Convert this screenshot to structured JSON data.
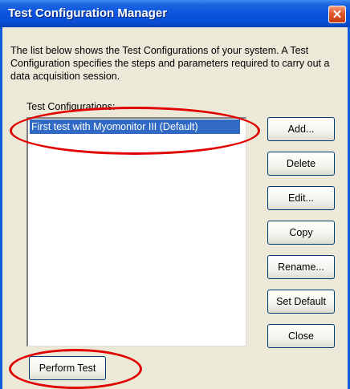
{
  "window": {
    "title": "Test Configuration Manager",
    "close_glyph": "✕"
  },
  "description": "The list below shows the Test Configurations of your system. A Test Configuration specifies the steps and parameters required to carry out a data acquisition session.",
  "list": {
    "label": "Test Configurations:",
    "items": [
      {
        "label": "First test with Myomonitor III  (Default)",
        "selected": true
      }
    ]
  },
  "buttons": {
    "add": "Add...",
    "delete": "Delete",
    "edit": "Edit...",
    "copy": "Copy",
    "rename": "Rename...",
    "set_default": "Set Default",
    "close": "Close",
    "perform_test": "Perform Test"
  },
  "colors": {
    "title_bar": "#0a55e0",
    "selection": "#316ac5",
    "annotation": "#e00000"
  }
}
